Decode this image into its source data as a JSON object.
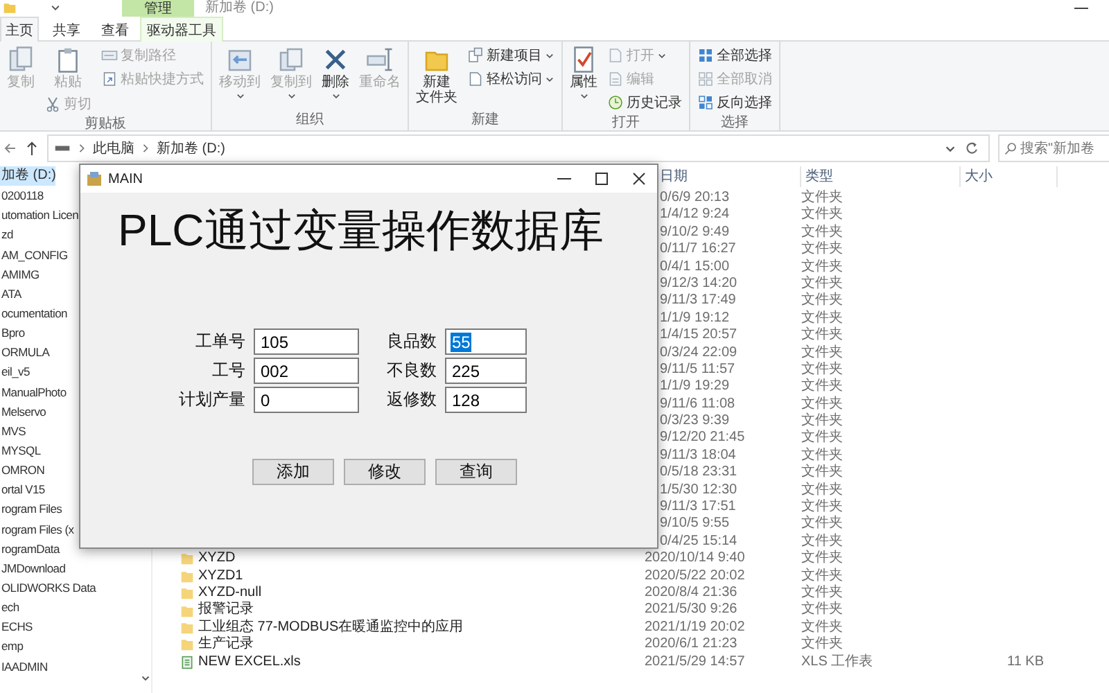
{
  "titlebar": {
    "context_tab": "管理",
    "title": "新加卷 (D:)"
  },
  "ribbon_tabs": [
    {
      "label": "主页",
      "selected": true
    },
    {
      "label": "共享",
      "selected": false
    },
    {
      "label": "查看",
      "selected": false
    },
    {
      "label": "驱动器工具",
      "selected": false
    }
  ],
  "ribbon_groups": [
    {
      "label": "剪贴板",
      "columns": [
        [
          {
            "label": "复制",
            "kind": "large",
            "disabled": true,
            "dropdown": false
          }
        ],
        [
          {
            "label": "粘贴",
            "kind": "large",
            "disabled": true,
            "dropdown": false
          },
          {
            "label": "剪切",
            "kind": "small",
            "disabled": true,
            "dropdown": false
          }
        ],
        [
          {
            "label": "复制路径",
            "kind": "small",
            "disabled": true,
            "dropdown": false
          },
          {
            "label": "粘贴快捷方式",
            "kind": "small",
            "disabled": true,
            "dropdown": false
          }
        ]
      ]
    },
    {
      "label": "组织",
      "columns": [
        [
          {
            "label": "移动到",
            "kind": "large",
            "disabled": true,
            "dropdown": true
          }
        ],
        [
          {
            "label": "复制到",
            "kind": "large",
            "disabled": true,
            "dropdown": true
          }
        ],
        [
          {
            "label": "删除",
            "kind": "large",
            "disabled": false,
            "dropdown": true
          }
        ],
        [
          {
            "label": "重命名",
            "kind": "large",
            "disabled": true,
            "dropdown": false
          }
        ]
      ]
    },
    {
      "label": "新建",
      "columns": [
        [
          {
            "label": "新建文件夹",
            "kind": "wrapped",
            "disabled": false,
            "dropdown": false
          }
        ],
        [
          {
            "label": "新建项目",
            "kind": "small",
            "disabled": false,
            "dropdown": true
          },
          {
            "label": "轻松访问",
            "kind": "small",
            "disabled": false,
            "dropdown": true
          }
        ]
      ]
    },
    {
      "label": "打开",
      "columns": [
        [
          {
            "label": "属性",
            "kind": "large",
            "disabled": false,
            "dropdown": true
          }
        ],
        [
          {
            "label": "打开",
            "kind": "small",
            "disabled": true,
            "dropdown": true
          },
          {
            "label": "编辑",
            "kind": "small",
            "disabled": true,
            "dropdown": false
          },
          {
            "label": "历史记录",
            "kind": "small",
            "disabled": false,
            "dropdown": false
          }
        ]
      ]
    },
    {
      "label": "选择",
      "columns": [
        [
          {
            "label": "全部选择",
            "kind": "small",
            "disabled": false,
            "dropdown": false
          },
          {
            "label": "全部取消",
            "kind": "small",
            "disabled": true,
            "dropdown": false
          },
          {
            "label": "反向选择",
            "kind": "small",
            "disabled": false,
            "dropdown": false
          }
        ]
      ]
    }
  ],
  "address": {
    "crumbs": [
      "此电脑",
      "新加卷 (D:)"
    ],
    "search_placeholder": "搜索\"新加卷"
  },
  "nav_items": [
    {
      "label": "加卷 (D:)",
      "selected": true
    },
    {
      "label": "0200118",
      "selected": false
    },
    {
      "label": "utomation Licen",
      "selected": false
    },
    {
      "label": "zd",
      "selected": false
    },
    {
      "label": "AM_CONFIG",
      "selected": false
    },
    {
      "label": "AMIMG",
      "selected": false
    },
    {
      "label": "ATA",
      "selected": false
    },
    {
      "label": "ocumentation",
      "selected": false
    },
    {
      "label": "Bpro",
      "selected": false
    },
    {
      "label": "ORMULA",
      "selected": false
    },
    {
      "label": "eil_v5",
      "selected": false
    },
    {
      "label": "ManualPhoto",
      "selected": false
    },
    {
      "label": "Melservo",
      "selected": false
    },
    {
      "label": "MVS",
      "selected": false
    },
    {
      "label": "MYSQL",
      "selected": false
    },
    {
      "label": "OMRON",
      "selected": false
    },
    {
      "label": "ortal V15",
      "selected": false
    },
    {
      "label": "rogram Files",
      "selected": false
    },
    {
      "label": "rogram Files (x",
      "selected": false
    },
    {
      "label": "rogramData",
      "selected": false
    },
    {
      "label": "JMDownload",
      "selected": false
    },
    {
      "label": "OLIDWORKS Data",
      "selected": false
    },
    {
      "label": "ech",
      "selected": false
    },
    {
      "label": "ECHS",
      "selected": false
    },
    {
      "label": "emp",
      "selected": false
    },
    {
      "label": "IAADMIN",
      "selected": false
    }
  ],
  "file_columns": [
    "日期",
    "类型",
    "大小"
  ],
  "files": [
    {
      "kind": "covered",
      "date": "0/6/9 20:13",
      "type": "文件夹"
    },
    {
      "kind": "covered",
      "date": "1/4/12 9:24",
      "type": "文件夹"
    },
    {
      "kind": "covered",
      "date": "9/10/2 9:49",
      "type": "文件夹"
    },
    {
      "kind": "covered",
      "date": "0/11/7 16:27",
      "type": "文件夹"
    },
    {
      "kind": "covered",
      "date": "0/4/1 15:00",
      "type": "文件夹"
    },
    {
      "kind": "covered",
      "date": "9/12/3 14:20",
      "type": "文件夹"
    },
    {
      "kind": "covered",
      "date": "9/11/3 17:49",
      "type": "文件夹"
    },
    {
      "kind": "covered",
      "date": "1/1/9 19:12",
      "type": "文件夹"
    },
    {
      "kind": "covered",
      "date": "1/4/15 20:57",
      "type": "文件夹"
    },
    {
      "kind": "covered",
      "date": "0/3/24 22:09",
      "type": "文件夹"
    },
    {
      "kind": "covered",
      "date": "9/11/5 11:57",
      "type": "文件夹"
    },
    {
      "kind": "covered",
      "date": "1/1/9 19:29",
      "type": "文件夹"
    },
    {
      "kind": "covered",
      "date": "9/11/6 11:08",
      "type": "文件夹"
    },
    {
      "kind": "covered",
      "date": "0/3/23 9:39",
      "type": "文件夹"
    },
    {
      "kind": "covered",
      "date": "9/12/20 21:45",
      "type": "文件夹"
    },
    {
      "kind": "covered",
      "date": "9/11/3 18:04",
      "type": "文件夹"
    },
    {
      "kind": "covered",
      "date": "0/5/18 23:31",
      "type": "文件夹"
    },
    {
      "kind": "covered",
      "date": "1/5/30 12:30",
      "type": "文件夹"
    },
    {
      "kind": "covered",
      "date": "9/11/3 17:51",
      "type": "文件夹"
    },
    {
      "kind": "covered",
      "date": "9/10/5 9:55",
      "type": "文件夹"
    },
    {
      "kind": "covered",
      "date": "0/4/25 15:14",
      "type": "文件夹"
    },
    {
      "kind": "folder",
      "name": "XYZD",
      "date": "2020/10/14 9:40",
      "type": "文件夹"
    },
    {
      "kind": "folder",
      "name": "XYZD1",
      "date": "2020/5/22 20:02",
      "type": "文件夹"
    },
    {
      "kind": "folder",
      "name": "XYZD-null",
      "date": "2020/8/4 21:36",
      "type": "文件夹"
    },
    {
      "kind": "folder",
      "name": "报警记录",
      "date": "2021/5/30 9:26",
      "type": "文件夹"
    },
    {
      "kind": "folder",
      "name": "工业组态 77-MODBUS在暖通监控中的应用",
      "date": "2021/1/19 20:02",
      "type": "文件夹"
    },
    {
      "kind": "folder",
      "name": "生产记录",
      "date": "2020/6/1 21:23",
      "type": "文件夹"
    },
    {
      "kind": "spreadsheet",
      "name": "NEW EXCEL.xls",
      "date": "2021/5/29 14:57",
      "type": "XLS 工作表",
      "size": "11 KB"
    }
  ],
  "dialog": {
    "title": "MAIN",
    "heading": "PLC通过变量操作数据库",
    "left_fields": [
      {
        "label": "工单号",
        "value": "105",
        "text_selected": false
      },
      {
        "label": "工号",
        "value": "002",
        "text_selected": false
      },
      {
        "label": "计划产量",
        "value": "0",
        "text_selected": false
      }
    ],
    "right_fields": [
      {
        "label": "良品数",
        "value": "55",
        "text_selected": true
      },
      {
        "label": "不良数",
        "value": "225",
        "text_selected": false
      },
      {
        "label": "返修数",
        "value": "128",
        "text_selected": false
      }
    ],
    "buttons": [
      "添加",
      "修改",
      "查询"
    ]
  }
}
